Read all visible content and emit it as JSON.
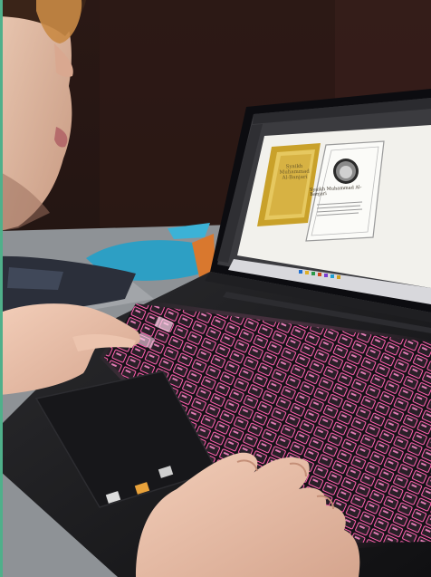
{
  "artboard": {
    "main_label": "Syaikh\nMuhammad\nAl-Banjari",
    "card_title": "Syaikh Muhammad Al-Banjari"
  },
  "colors": {
    "frame_gold": "#c9a12a",
    "keyboard_backlight": "#ff5fae",
    "canvas_white": "#f2f1ec"
  }
}
